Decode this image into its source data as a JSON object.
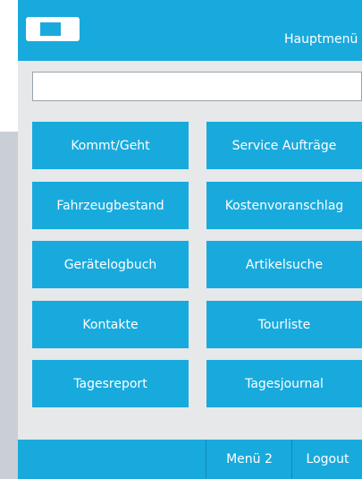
{
  "header": {
    "title": "Hauptmenü",
    "logo_icon": "device-logo-icon"
  },
  "search": {
    "value": "",
    "placeholder": ""
  },
  "menu": {
    "buttons": [
      "Kommt/Geht",
      "Service Aufträge",
      "Fahrzeugbestand",
      "Kostenvoranschlag",
      "Gerätelogbuch",
      "Artikelsuche",
      "Kontakte",
      "Tourliste",
      "Tagesreport",
      "Tagesjournal"
    ]
  },
  "footer": {
    "menu2": "Menü 2",
    "logout": "Logout"
  },
  "colors": {
    "accent": "#19aadd",
    "background": "#e6e8ea",
    "side_panel": "#c9cfd4"
  }
}
